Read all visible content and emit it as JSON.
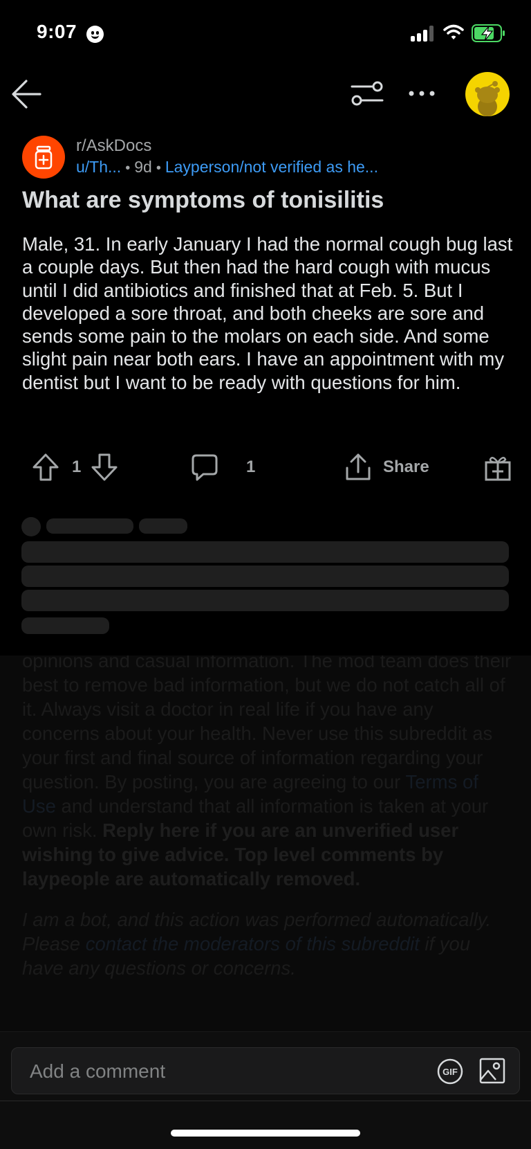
{
  "status_bar": {
    "time": "9:07"
  },
  "post": {
    "subreddit": "r/AskDocs",
    "author": "u/Th...",
    "age": "9d",
    "flair": "Layperson/not verified as he...",
    "title": "What are symptoms of tonisilitis",
    "body": "Male, 31. In early January I had the normal cough bug last a couple days. But then had the hard cough with mucus until I did antibiotics and finished that at Feb. 5. But I developed a sore throat, and both cheeks are sore and sends some pain to the molars on each side. And some slight pain near both ears. I have an appointment with my dentist but I want to be ready with questions for him.",
    "upvotes": "1",
    "comments": "1",
    "share_label": "Share"
  },
  "bot_comment": {
    "text_1": "opinions and casual information. The mod team does their best to remove bad information, but we do not catch all of it. Always visit a doctor in real life if you have any concerns about your health. Never use this subreddit as your first and final source of information regarding your question. By posting, you are agreeing to our ",
    "terms_link": "Terms of Use",
    "text_2": " and understand that all information is taken at your own risk. ",
    "bold_text": "Reply here if you are an unverified user wishing to give advice. Top level comments by laypeople are automatically removed.",
    "italic_1": "I am a bot, and this action was performed automatically. Please ",
    "contact_link": "contact the moderators of this subreddit",
    "italic_2": " if you have any questions or concerns."
  },
  "comment_bar": {
    "placeholder": "Add a comment"
  },
  "colors": {
    "accent_orange": "#ff4500",
    "link_blue": "#3d9bf5",
    "avatar_yellow": "#f5d400",
    "battery_green": "#4cd964"
  }
}
